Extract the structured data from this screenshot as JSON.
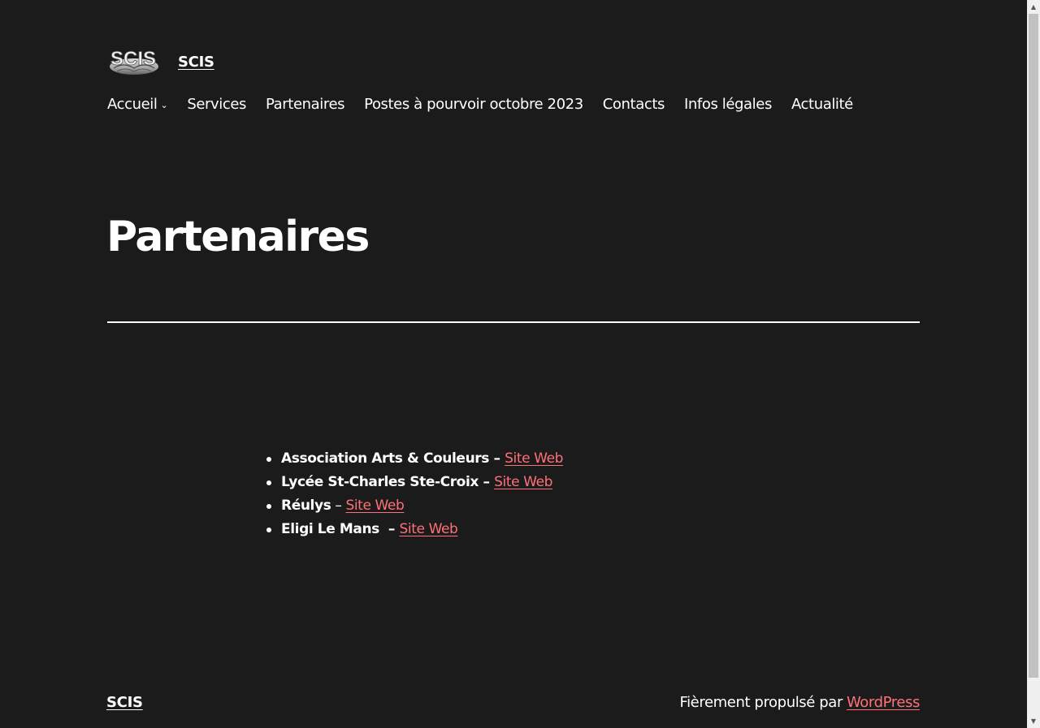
{
  "header": {
    "logo_text": "SCIS",
    "site_title": "SCIS"
  },
  "nav": {
    "items": [
      {
        "label": "Accueil",
        "has_submenu": true
      },
      {
        "label": "Services"
      },
      {
        "label": "Partenaires"
      },
      {
        "label": "Postes à pourvoir octobre 2023"
      },
      {
        "label": "Contacts"
      },
      {
        "label": "Infos légales"
      },
      {
        "label": "Actualité"
      }
    ]
  },
  "main": {
    "title": "Partenaires",
    "partners": [
      {
        "name": "Association Arts & Couleurs",
        "sep": " – ",
        "link": "Site Web"
      },
      {
        "name": "Lycée St-Charles Ste-Croix",
        "sep": " – ",
        "link": "Site Web"
      },
      {
        "name": "Réulys",
        "sep": " – ",
        "link": "Site Web"
      },
      {
        "name": "Eligi Le Mans",
        "sep": "  – ",
        "link": "Site Web"
      }
    ]
  },
  "footer": {
    "site_title": "SCIS",
    "powered_text": "Fièrement propulsé par",
    "powered_link": "WordPress"
  },
  "colors": {
    "background": "#1b1b1b",
    "text": "#ffffff",
    "link": "#ff7179"
  }
}
